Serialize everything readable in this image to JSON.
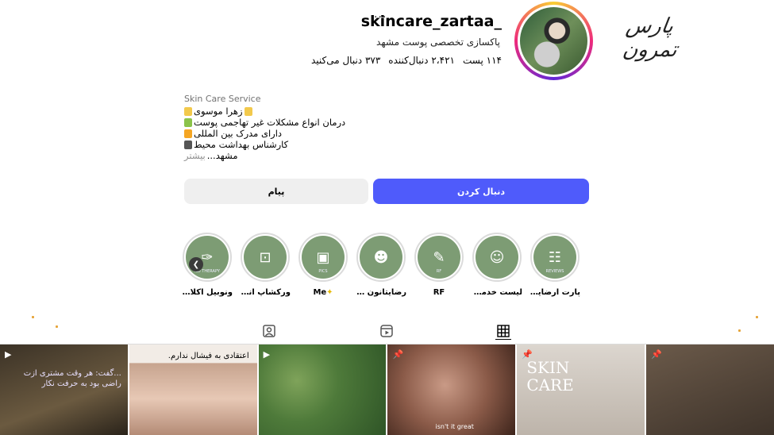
{
  "brand": {
    "logo_text": "پارس تمرون"
  },
  "profile": {
    "username": "skincare_zartaa_",
    "more_icon": "more-dots-icon",
    "subtitle": "پاکسازی تخصصی پوست مشهد",
    "stats": {
      "posts": "۱۱۴ پست",
      "followers": "۲،۴۲۱ دنبال‌کننده",
      "following": "۳۷۳ دنبال می‌کنید"
    },
    "category": "Skin Care Service",
    "bio": [
      {
        "text": "زهرا موسوی",
        "emoji_color": "#f2c94c"
      },
      {
        "text": "درمان انواع مشکلات غیر تهاجمی پوست",
        "emoji_color": "#8bc34a"
      },
      {
        "text": "دارای مدرک بین المللی",
        "emoji_color": "#f5a623"
      },
      {
        "text": "کارشناس بهداشت محیط",
        "emoji_color": "#555555"
      }
    ],
    "bio_tail": {
      "location": "مشهد...",
      "more": "بیشتر"
    }
  },
  "actions": {
    "follow": "دنبال کردن",
    "message": "پیام"
  },
  "highlights": [
    {
      "label": "پارت آرضایتانو...",
      "tag": "REVIEWS",
      "icon": "reviews-bubble-icon"
    },
    {
      "label": "لیست خدمات",
      "tag": "",
      "icon": "face-mask-icon"
    },
    {
      "label": "RF",
      "tag": "RF",
      "icon": "rf-device-icon"
    },
    {
      "label": "رضایتانون ا...",
      "tag": "",
      "icon": "face-profile-icon"
    },
    {
      "label": "Me",
      "tag": "PICS",
      "icon": "photos-icon"
    },
    {
      "label": "ورکشاپ آناپارلا",
      "tag": "",
      "icon": "presentation-board-icon"
    },
    {
      "label": "ونوبیل اکلادو",
      "tag": "ND THERAPY",
      "icon": "therapy-brush-icon"
    }
  ],
  "tabs": [
    {
      "name": "tagged",
      "icon": "tagged-user-icon"
    },
    {
      "name": "reels",
      "icon": "reels-icon"
    },
    {
      "name": "posts",
      "icon": "grid-icon",
      "active": true
    }
  ],
  "posts": [
    {
      "text": "...گفت: هر وقت مشتری ازت راضی بود به حرفت نکار",
      "badge": "reel-icon",
      "bg": "#4a3d2e"
    },
    {
      "text": "اعتقادی به فیشال ندارم.",
      "badge": "",
      "bg": "#d9c7bd"
    },
    {
      "text": "",
      "badge": "reel-icon",
      "bg": "#4e7a3a"
    },
    {
      "text": "isn't it great",
      "badge": "pin-icon",
      "bg": "#8a5a48"
    },
    {
      "text": "SKIN CARE",
      "badge": "pin-icon",
      "bg": "#cfc9c2"
    },
    {
      "text": "",
      "badge": "pin-icon",
      "bg": "#5a4a3e"
    }
  ]
}
